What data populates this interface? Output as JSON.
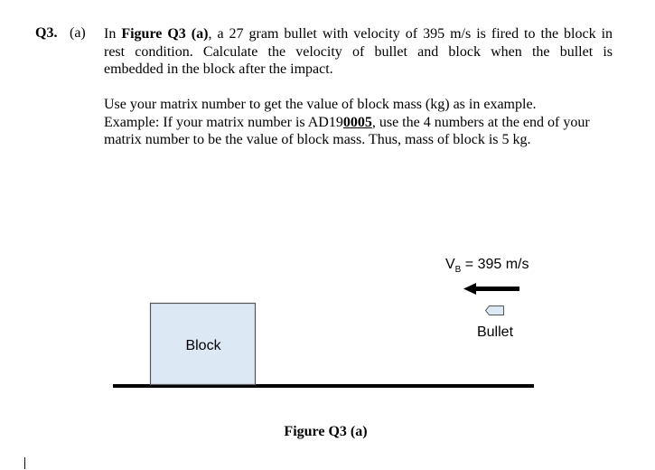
{
  "question": {
    "number": "Q3.",
    "part": "(a)",
    "paragraph1": {
      "prefix": "In ",
      "figure_ref": "Figure Q3 (a)",
      "line1_rest": ", a 27 gram bullet with velocity of 395 m/s is fired to the block in",
      "line2": "rest condition. Calculate the velocity of bullet and block when the bullet is",
      "line3": "embedded in the block after the impact."
    },
    "paragraph2": {
      "line1": "Use your matrix number to get the value of block mass (kg) as in example.",
      "line2_prefix": "Example: If your matrix number is AD19",
      "line2_underlined": "0005",
      "line2_suffix": ", use the 4 numbers at the end of your",
      "line3": "matrix number to be the value of block mass. Thus, mass of block is 5 kg."
    }
  },
  "figure": {
    "block_label": "Block",
    "bullet_label": "Bullet",
    "velocity_symbol": "V",
    "velocity_subscript": "B",
    "velocity_value": " = 395 m/s",
    "caption": "Figure Q3 (a)",
    "colors": {
      "block_fill": "#dde8f5",
      "block_stroke": "#555555",
      "bullet_fill": "#dde8f5",
      "ground": "#000000",
      "arrow": "#000000"
    }
  }
}
